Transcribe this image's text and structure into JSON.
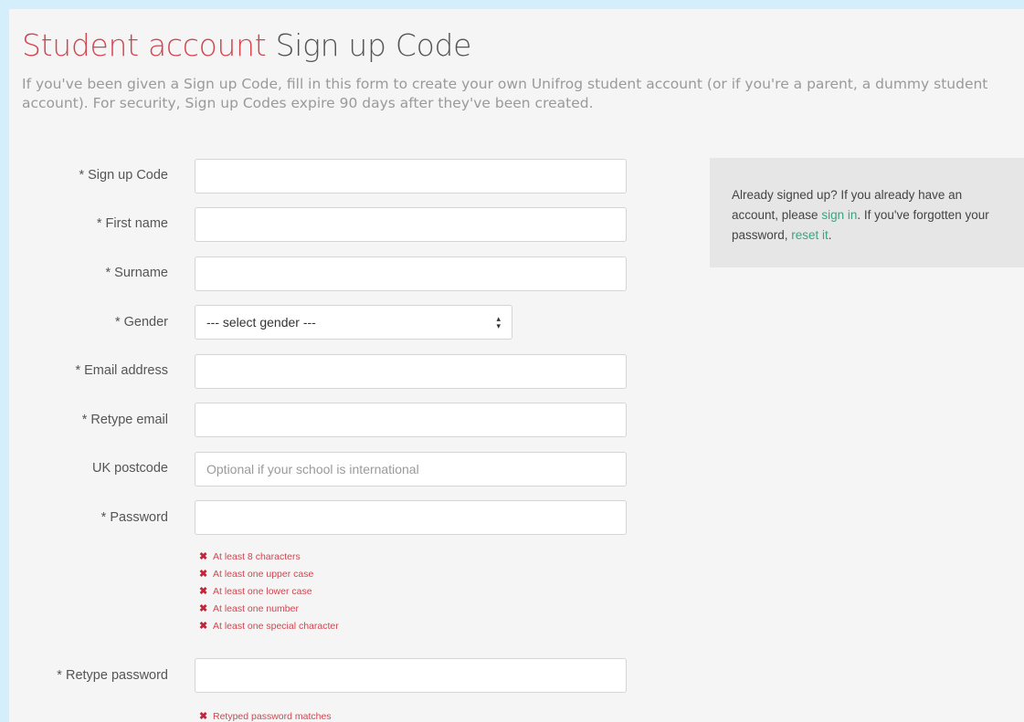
{
  "page": {
    "title_accent": "Student account",
    "title_main": "Sign up Code",
    "intro": "If you've been given a Sign up Code, fill in this form to create your own Unifrog student account (or if you're a parent, a dummy student account). For security, Sign up Codes expire 90 days after they've been created."
  },
  "form": {
    "fields": {
      "signup_code": {
        "label": "* Sign up Code",
        "value": "",
        "placeholder": ""
      },
      "first_name": {
        "label": "* First name",
        "value": "",
        "placeholder": ""
      },
      "surname": {
        "label": "* Surname",
        "value": "",
        "placeholder": ""
      },
      "gender": {
        "label": "* Gender",
        "selected": "--- select gender ---"
      },
      "email": {
        "label": "* Email address",
        "value": "",
        "placeholder": ""
      },
      "retype_email": {
        "label": "* Retype email",
        "value": "",
        "placeholder": ""
      },
      "postcode": {
        "label": "UK postcode",
        "value": "",
        "placeholder": "Optional if your school is international"
      },
      "password": {
        "label": "* Password",
        "value": "",
        "placeholder": ""
      },
      "retype_password": {
        "label": "* Retype password",
        "value": "",
        "placeholder": ""
      }
    },
    "password_rules": [
      "At least 8 characters",
      "At least one upper case",
      "At least one lower case",
      "At least one number",
      "At least one special character"
    ],
    "retype_rules": [
      "Retyped password matches"
    ],
    "rule_color": "#d2454f"
  },
  "aside": {
    "text_1": "Already signed up? If you already have an account, please ",
    "sign_in_link": "sign in",
    "text_2": ". If you've forgotten your password, ",
    "reset_link": "reset it",
    "text_3": "."
  },
  "colors": {
    "accent_red": "#d2454f",
    "link_green": "#3aa57f",
    "frame_blue": "#d4eefb"
  }
}
